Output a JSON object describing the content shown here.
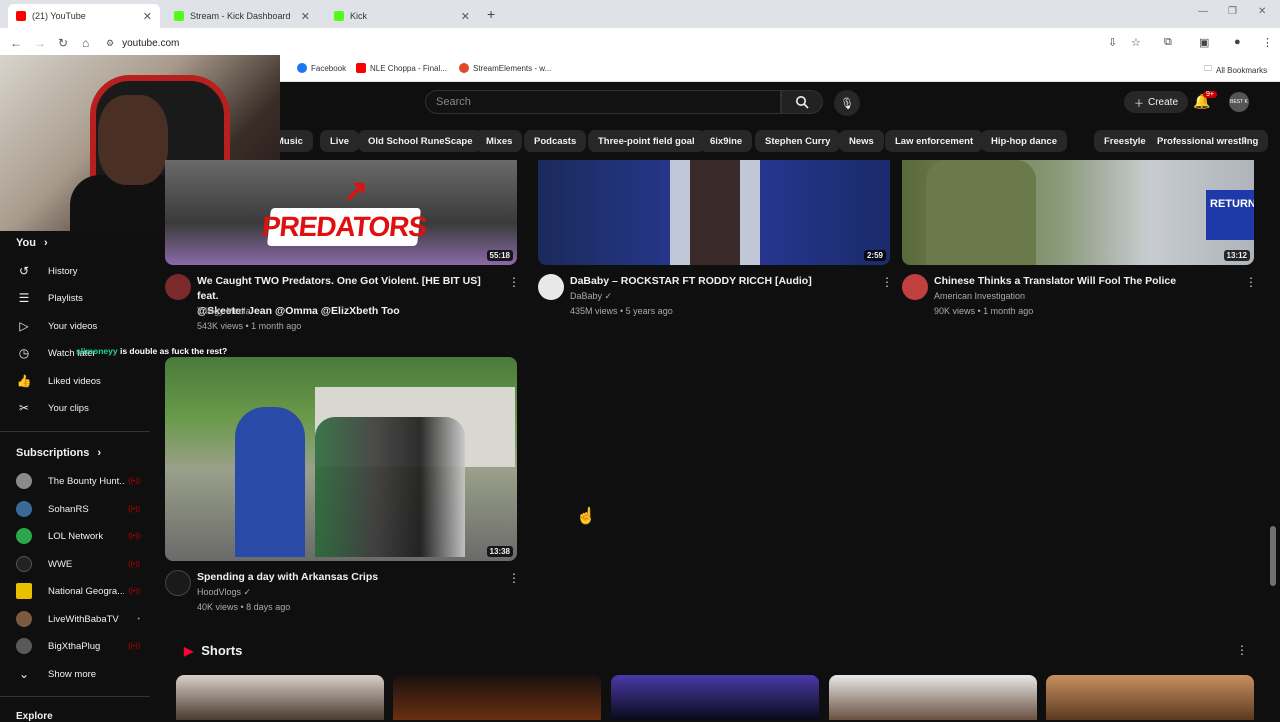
{
  "browser": {
    "tabs": [
      {
        "label": "(21) YouTube",
        "favicon": "youtube-icon"
      },
      {
        "label": "Stream - Kick Dashboard",
        "favicon": "kick-icon"
      },
      {
        "label": "Kick",
        "favicon": "kick-icon"
      }
    ],
    "url": "youtube.com",
    "bookmarks": [
      "Facebook",
      "NLE Choppa - Final...",
      "StreamElements - w...",
      "All Bookmarks"
    ]
  },
  "header": {
    "search_placeholder": "Search",
    "create_label": "Create",
    "notifications_badge": "9+",
    "avatar_text": "BEST K"
  },
  "chips": [
    "Music",
    "Live",
    "Old School RuneScape",
    "Mixes",
    "Podcasts",
    "Three-point field goal",
    "6ix9ine",
    "Stephen Curry",
    "News",
    "Law enforcement",
    "Hip-hop dance",
    "Freestyle Rap",
    "Professional wrestling"
  ],
  "sidebar": {
    "you_label": "You",
    "items": [
      {
        "label": "History",
        "icon": "history-icon"
      },
      {
        "label": "Playlists",
        "icon": "playlists-icon"
      },
      {
        "label": "Your videos",
        "icon": "your-videos-icon"
      },
      {
        "label": "Watch later",
        "icon": "watch-later-icon"
      },
      {
        "label": "Liked videos",
        "icon": "like-icon"
      },
      {
        "label": "Your clips",
        "icon": "scissors-icon"
      }
    ],
    "subscriptions_label": "Subscriptions",
    "subscriptions": [
      {
        "name": "The Bounty Hunt...",
        "color": "#8a8a8a"
      },
      {
        "name": "SohanRS",
        "color": "#3a6a9a"
      },
      {
        "name": "LOL Network",
        "color": "#2aa84a"
      },
      {
        "name": "WWE",
        "color": "#222222"
      },
      {
        "name": "National Geogra...",
        "color": "#e8c000"
      },
      {
        "name": "LiveWithBabaTV",
        "color": "#7a5a40"
      },
      {
        "name": "BigXthaPlug",
        "color": "#5a5a5a"
      }
    ],
    "show_more_label": "Show more",
    "explore_label": "Explore"
  },
  "chat_overlay": {
    "user": "slimoneyy",
    "message": "is double as fuck the rest?"
  },
  "videos": [
    {
      "title_line1": "We Caught TWO Predators. One Got Violent. [HE BIT US] feat.",
      "title_line2": "@Skeeter Jean @Omma @ElizXbeth Too",
      "channel": "Trilogy Media",
      "meta": "543K views • 1 month ago",
      "duration": "55:18",
      "thumb_text": "PREDATORS"
    },
    {
      "title_line1": "DaBaby – ROCKSTAR FT RODDY RICCH [Audio]",
      "channel": "DaBaby",
      "meta": "435M views • 5 years ago",
      "duration": "2:59"
    },
    {
      "title_line1": "Chinese Thinks a Translator Will Fool The Police",
      "channel": "American Investigation",
      "meta": "90K views • 1 month ago",
      "duration": "13:12",
      "thumb_text": "RETURN"
    },
    {
      "title_line1": "Spending a day with Arkansas Crips",
      "channel": "HoodVlogs",
      "meta": "40K views • 8 days ago",
      "duration": "13:38"
    }
  ],
  "shorts_label": "Shorts"
}
